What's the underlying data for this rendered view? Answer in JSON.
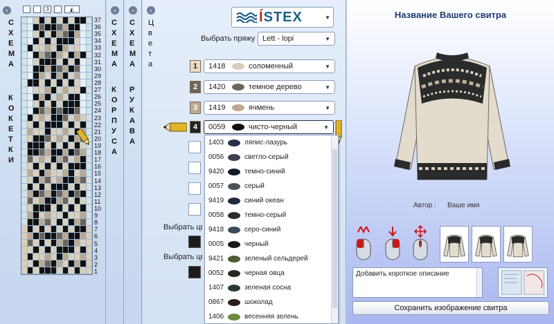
{
  "panels": {
    "yoke_label": "СХЕМА КОКЕТКИ",
    "body_label": "СХЕМА КОРПУСА",
    "sleeve_label": "СХЕМА РУКАВА",
    "colors_label": "Цвета"
  },
  "yoke_tools": {
    "tool_3": "3"
  },
  "yoke_rows": [
    "37",
    "36",
    "35",
    "34",
    "33",
    "32",
    "31",
    "30",
    "29",
    "28",
    "27",
    "26",
    "25",
    "24",
    "23",
    "22",
    "21",
    "20",
    "19",
    "18",
    "17",
    "16",
    "15",
    "14",
    "13",
    "12",
    "11",
    "10",
    "9",
    "8",
    "7",
    "6",
    "5",
    "4",
    "3",
    "2",
    "1"
  ],
  "logo": {
    "text_main": "ÍSTEX",
    "text_accent": "Í",
    "text_rest": "STEX"
  },
  "yarn": {
    "label": "Выбрать пряжу :",
    "value": "Lett - lopi"
  },
  "selected_colors": [
    {
      "num": "1",
      "code": "1418",
      "name": "соломенный",
      "swatch": "#d9cfbc"
    },
    {
      "num": "2",
      "code": "1420",
      "name": "темное дерево",
      "swatch": "#6e6458"
    },
    {
      "num": "3",
      "code": "1419",
      "name": "ячмень",
      "swatch": "#bca98f"
    },
    {
      "num": "4",
      "code": "0059",
      "name": "чисто-черный",
      "swatch": "#111111"
    }
  ],
  "side_labels": {
    "label_a": "Выбрать цв",
    "label_b": "Выбрать цв"
  },
  "color_list": [
    {
      "code": "1403",
      "name": "ляпис-лазурь",
      "swatch": "#24304d"
    },
    {
      "code": "0056",
      "name": "светло-серый",
      "swatch": "#3b3f4e"
    },
    {
      "code": "9420",
      "name": "темно-синий",
      "swatch": "#151a2b"
    },
    {
      "code": "0057",
      "name": "серый",
      "swatch": "#4d5158"
    },
    {
      "code": "9419",
      "name": "синий океан",
      "swatch": "#1f2a3c"
    },
    {
      "code": "0058",
      "name": "темно-серый",
      "swatch": "#2a2c33"
    },
    {
      "code": "9418",
      "name": "серо-синий",
      "swatch": "#3e4b5e"
    },
    {
      "code": "0005",
      "name": "черный",
      "swatch": "#1a1a1a"
    },
    {
      "code": "9421",
      "name": "зеленый сельдерей",
      "swatch": "#4c5d36"
    },
    {
      "code": "0052",
      "name": "черная овца",
      "swatch": "#2a2723"
    },
    {
      "code": "1407",
      "name": "зеленая сосна",
      "swatch": "#2c3b2c"
    },
    {
      "code": "0867",
      "name": "шоколад",
      "swatch": "#2a1d18"
    },
    {
      "code": "1406",
      "name": "весенняя зелень",
      "swatch": "#6c8b3c"
    }
  ],
  "preview": {
    "title": "Название Вашего свитра",
    "author_label": "Автор :",
    "author_name": "Ваше имя",
    "description_placeholder": "Добавить короткое описание",
    "save_button": "Сохранить изображение свитра"
  },
  "colors": {
    "cream": "#d9cfbc",
    "dark_wood": "#6e6458",
    "barley": "#bca98f",
    "black": "#111111",
    "accent_red": "#c8181c"
  }
}
